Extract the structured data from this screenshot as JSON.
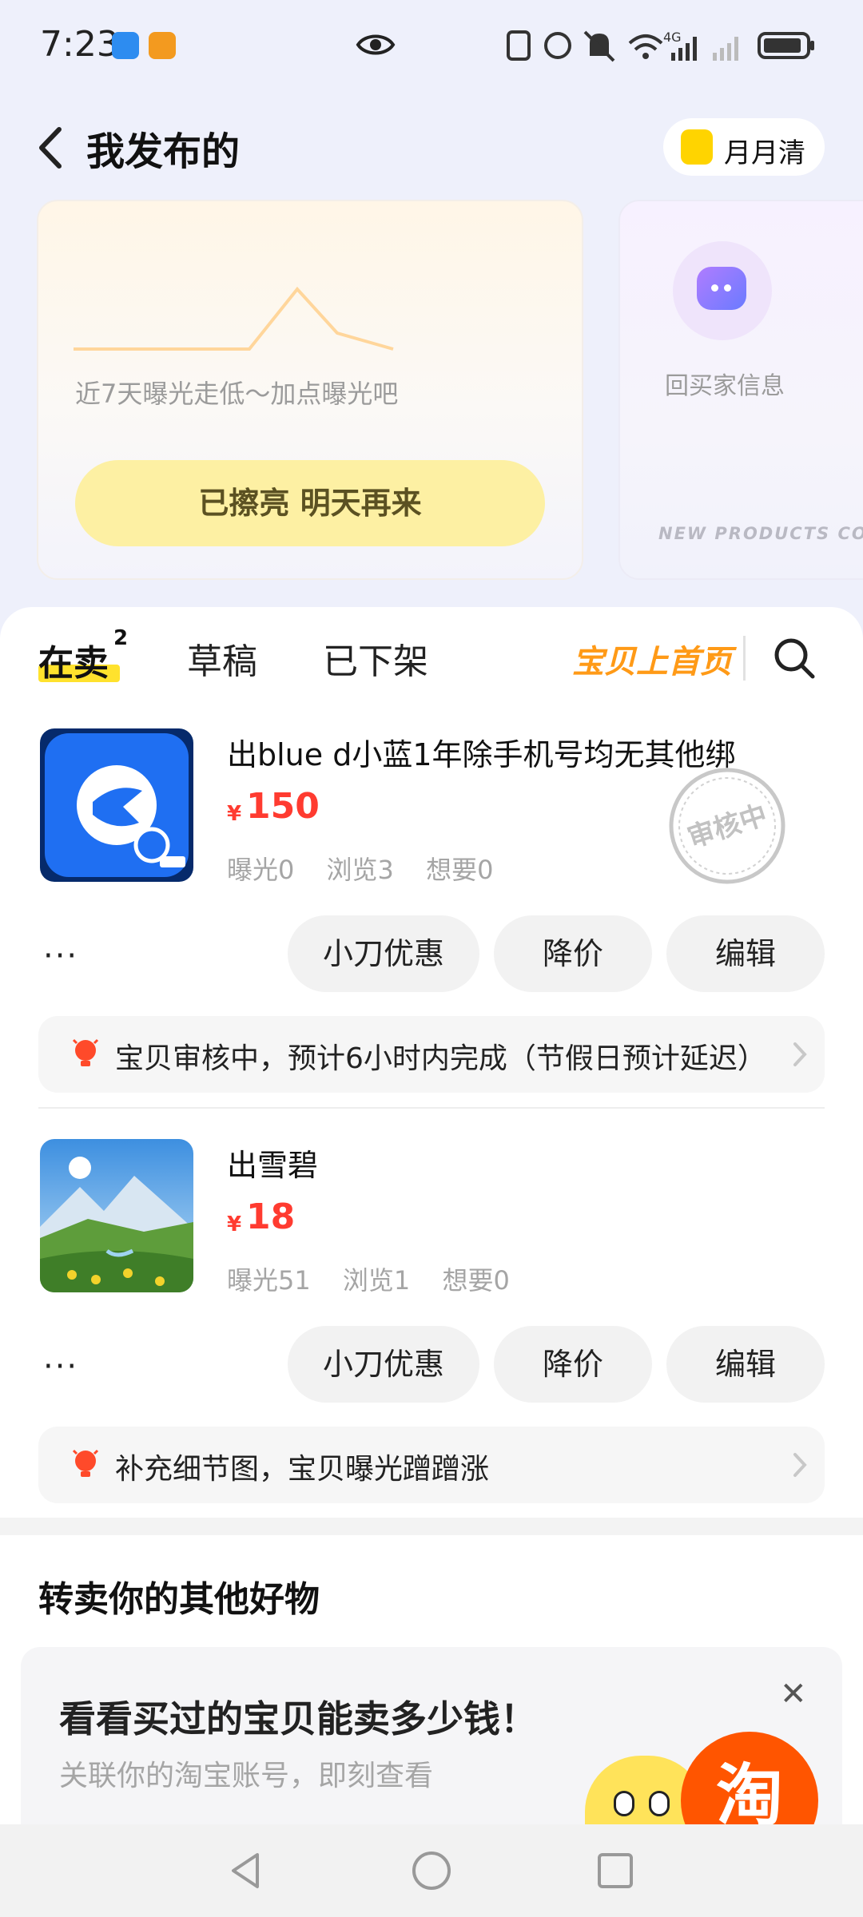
{
  "status_bar": {
    "time": "7:23",
    "network": "4G"
  },
  "header": {
    "title": "我发布的",
    "vip_label": "月月清"
  },
  "exposure_card": {
    "hint": "近7天曝光走低～加点曝光吧",
    "button_label": "已擦亮 明天再来"
  },
  "reply_card": {
    "label": "回买家信息",
    "banner": "NEW PRODUCTS CO"
  },
  "tabs": {
    "selling": {
      "label": "在卖",
      "count": "2"
    },
    "draft": {
      "label": "草稿"
    },
    "off": {
      "label": "已下架"
    },
    "promote": {
      "label": "宝贝上首页"
    }
  },
  "items": [
    {
      "title": "出blue d小蓝1年除手机号均无其他绑",
      "price_symbol": "¥",
      "price": "150",
      "stats": [
        "曝光0",
        "浏览3",
        "想要0"
      ],
      "stamp": "审核中",
      "actions": [
        "小刀优惠",
        "降价",
        "编辑"
      ],
      "tip": "宝贝审核中，预计6小时内完成（节假日预计延迟）"
    },
    {
      "title": "出雪碧",
      "price_symbol": "¥",
      "price": "18",
      "stats": [
        "曝光51",
        "浏览1",
        "想要0"
      ],
      "actions": [
        "小刀优惠",
        "降价",
        "编辑"
      ],
      "tip": "补充细节图，宝贝曝光蹭蹭涨"
    }
  ],
  "more_label": "···",
  "resell": {
    "title": "转卖你的其他好物",
    "promo_title": "看看买过的宝贝能卖多少钱！",
    "promo_sub": "关联你的淘宝账号，即刻查看",
    "promo_close": "✕",
    "taobao_char": "淘"
  },
  "colors": {
    "accent_orange": "#ff9a17",
    "price_red": "#ff3b30",
    "highlight_yellow": "#ffe22d",
    "boost_button": "#fdf0a3"
  }
}
